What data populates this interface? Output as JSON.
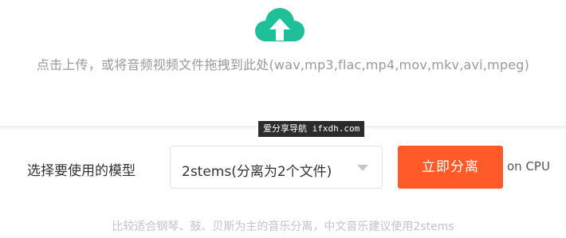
{
  "upload": {
    "icon": "cloud-upload-icon",
    "icon_color": "#1fbf9a",
    "prompt": "点击上传，或将音频视频文件拖拽到此处(wav,mp3,flac,mp4,mov,mkv,avi,mpeg)"
  },
  "watermark": "爱分享导航 ifxdh.com",
  "model": {
    "label": "选择要使用的模型",
    "selected": "2stems(分离为2个文件)"
  },
  "action": {
    "button_label": "立即分离",
    "button_color": "#ff5a28",
    "device": "on CPU"
  },
  "hint": "比较适合钢琴、鼓、贝斯为主的音乐分离，中文音乐建议使用2stems"
}
